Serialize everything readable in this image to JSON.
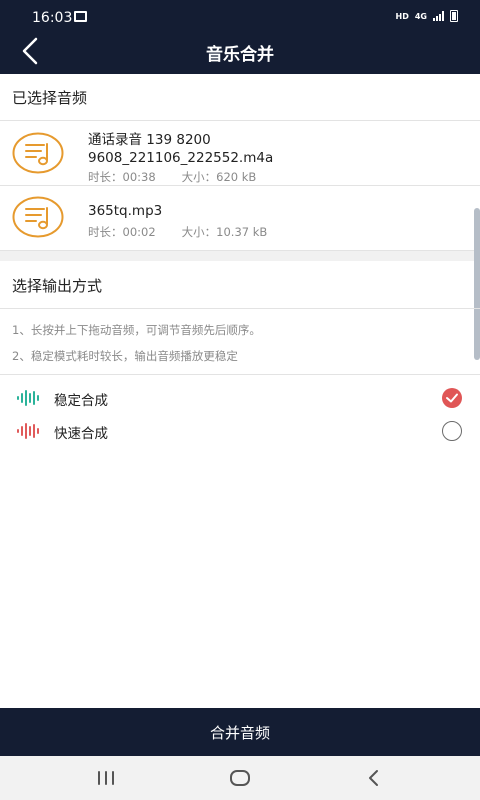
{
  "status_bar": {
    "time": "16:03",
    "hd_label": "HD",
    "network_label": "4G"
  },
  "header": {
    "title": "音乐合并",
    "back_icon": "chevron-left-icon"
  },
  "selected_section": {
    "title": "已选择音频",
    "files": [
      {
        "name_line1": "通话录音 139 8200",
        "name_line2": "9608_221106_222552.m4a",
        "duration": "时长：00:38",
        "size": "大小：620 kB"
      },
      {
        "name_line1": "365tq.mp3",
        "name_line2": "",
        "duration": "时长：00:02",
        "size": "大小：10.37 kB"
      }
    ]
  },
  "output_section": {
    "title": "选择输出方式",
    "hints": [
      "1、长按并上下拖动音频，可调节音频先后顺序。",
      "2、稳定模式耗时较长，输出音频播放更稳定"
    ],
    "options": [
      {
        "label": "稳定合成",
        "selected": true,
        "wave_color": "#2bb39a"
      },
      {
        "label": "快速合成",
        "selected": false,
        "wave_color": "#e05a5a"
      }
    ]
  },
  "actions": {
    "merge_label": "合并音频"
  },
  "colors": {
    "bar_bg": "#141d33",
    "accent_orange": "#e69a2e",
    "radio_checked": "#e05656"
  }
}
